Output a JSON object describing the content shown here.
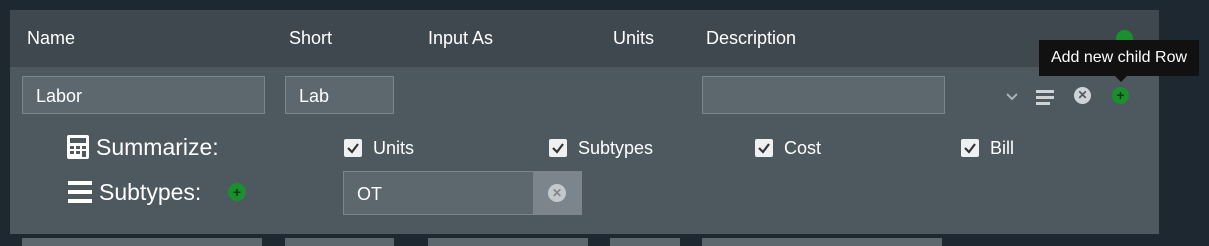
{
  "header": {
    "columns": [
      "Name",
      "Short",
      "Input As",
      "Units",
      "Description"
    ],
    "add_icon": "plus-circle-icon"
  },
  "row": {
    "name_value": "Labor",
    "short_value": "Lab",
    "description_value": "",
    "icons": [
      "chevron-down-icon",
      "list-lines-icon",
      "close-circle-icon",
      "plus-circle-icon"
    ]
  },
  "tooltip": {
    "text": "Add new child Row"
  },
  "summarize": {
    "label": "Summarize:",
    "icon": "calculator-icon",
    "options": [
      {
        "label": "Units",
        "checked": true
      },
      {
        "label": "Subtypes",
        "checked": true
      },
      {
        "label": "Cost",
        "checked": true
      },
      {
        "label": "Bill",
        "checked": true
      }
    ]
  },
  "subtypes": {
    "label": "Subtypes:",
    "icon": "list-lines-icon",
    "value": "OT"
  },
  "colors": {
    "background": "#1d2830",
    "panel": "#4e585f",
    "header": "#3f484e",
    "accent_green": "#1a8f2e"
  }
}
